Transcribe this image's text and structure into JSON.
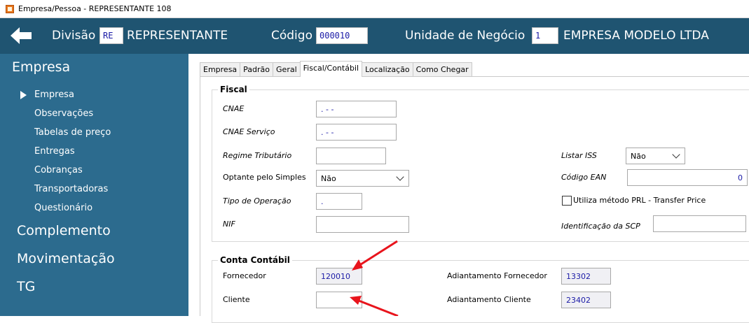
{
  "window": {
    "title": "Empresa/Pessoa - REPRESENTANTE  108"
  },
  "header": {
    "divisao_label": "Divisão",
    "divisao_code": "RE",
    "divisao_name": "REPRESENTANTE",
    "codigo_label": "Código",
    "codigo_value": "000010",
    "unidade_label": "Unidade de Negócio",
    "unidade_code": "1",
    "unidade_name": "EMPRESA MODELO LTDA"
  },
  "sidebar": {
    "section_title": "Empresa",
    "items": [
      {
        "label": "Empresa",
        "active": true
      },
      {
        "label": "Observações"
      },
      {
        "label": "Tabelas de preço"
      },
      {
        "label": "Entregas"
      },
      {
        "label": "Cobranças"
      },
      {
        "label": "Transportadoras"
      },
      {
        "label": "Questionário"
      }
    ],
    "complemento": "Complemento",
    "movimentacao": "Movimentação",
    "tg": "TG"
  },
  "tabs": [
    {
      "label": "Empresa"
    },
    {
      "label": "Padrão"
    },
    {
      "label": "Geral"
    },
    {
      "label": "Fiscal/Contábil",
      "active": true
    },
    {
      "label": "Localização"
    },
    {
      "label": "Como Chegar"
    }
  ],
  "fiscal": {
    "title": "Fiscal",
    "cnae_label": "CNAE",
    "cnae_value": " .  - -",
    "cnae_servico_label": "CNAE Serviço",
    "cnae_servico_value": " .  - -",
    "regime_label": "Regime Tributário",
    "regime_value": "",
    "optante_label": "Optante pelo Simples",
    "optante_value": "Não",
    "tipo_operacao_label": "Tipo de Operação",
    "tipo_operacao_value": " .",
    "nif_label": "NIF",
    "nif_value": "",
    "listar_iss_label": "Listar  ISS",
    "listar_iss_value": "Não",
    "codigo_ean_label": "Código EAN",
    "codigo_ean_value": "0",
    "prl_label": "Utiliza método PRL - Transfer Price",
    "prl_checked": false,
    "scp_label": "Identificação da SCP",
    "scp_value": ""
  },
  "conta_contabil": {
    "title": "Conta Contábil",
    "fornecedor_label": "Fornecedor",
    "fornecedor_value": "120010",
    "cliente_label": "Cliente",
    "cliente_value": "",
    "adiant_fornecedor_label": "Adiantamento Fornecedor",
    "adiant_fornecedor_value": "13302",
    "adiant_cliente_label": "Adiantamento Cliente",
    "adiant_cliente_value": "23402"
  },
  "icons": {
    "back": "arrow-left-icon",
    "app": "app-icon",
    "active_item": "triangle-right-icon",
    "dropdown": "chevron-down-icon"
  },
  "colors": {
    "header_bg": "#1f5471",
    "sidebar_bg": "#2c6b8e",
    "value_text": "#1a1aa6",
    "annotation_arrow": "#e8141c"
  }
}
